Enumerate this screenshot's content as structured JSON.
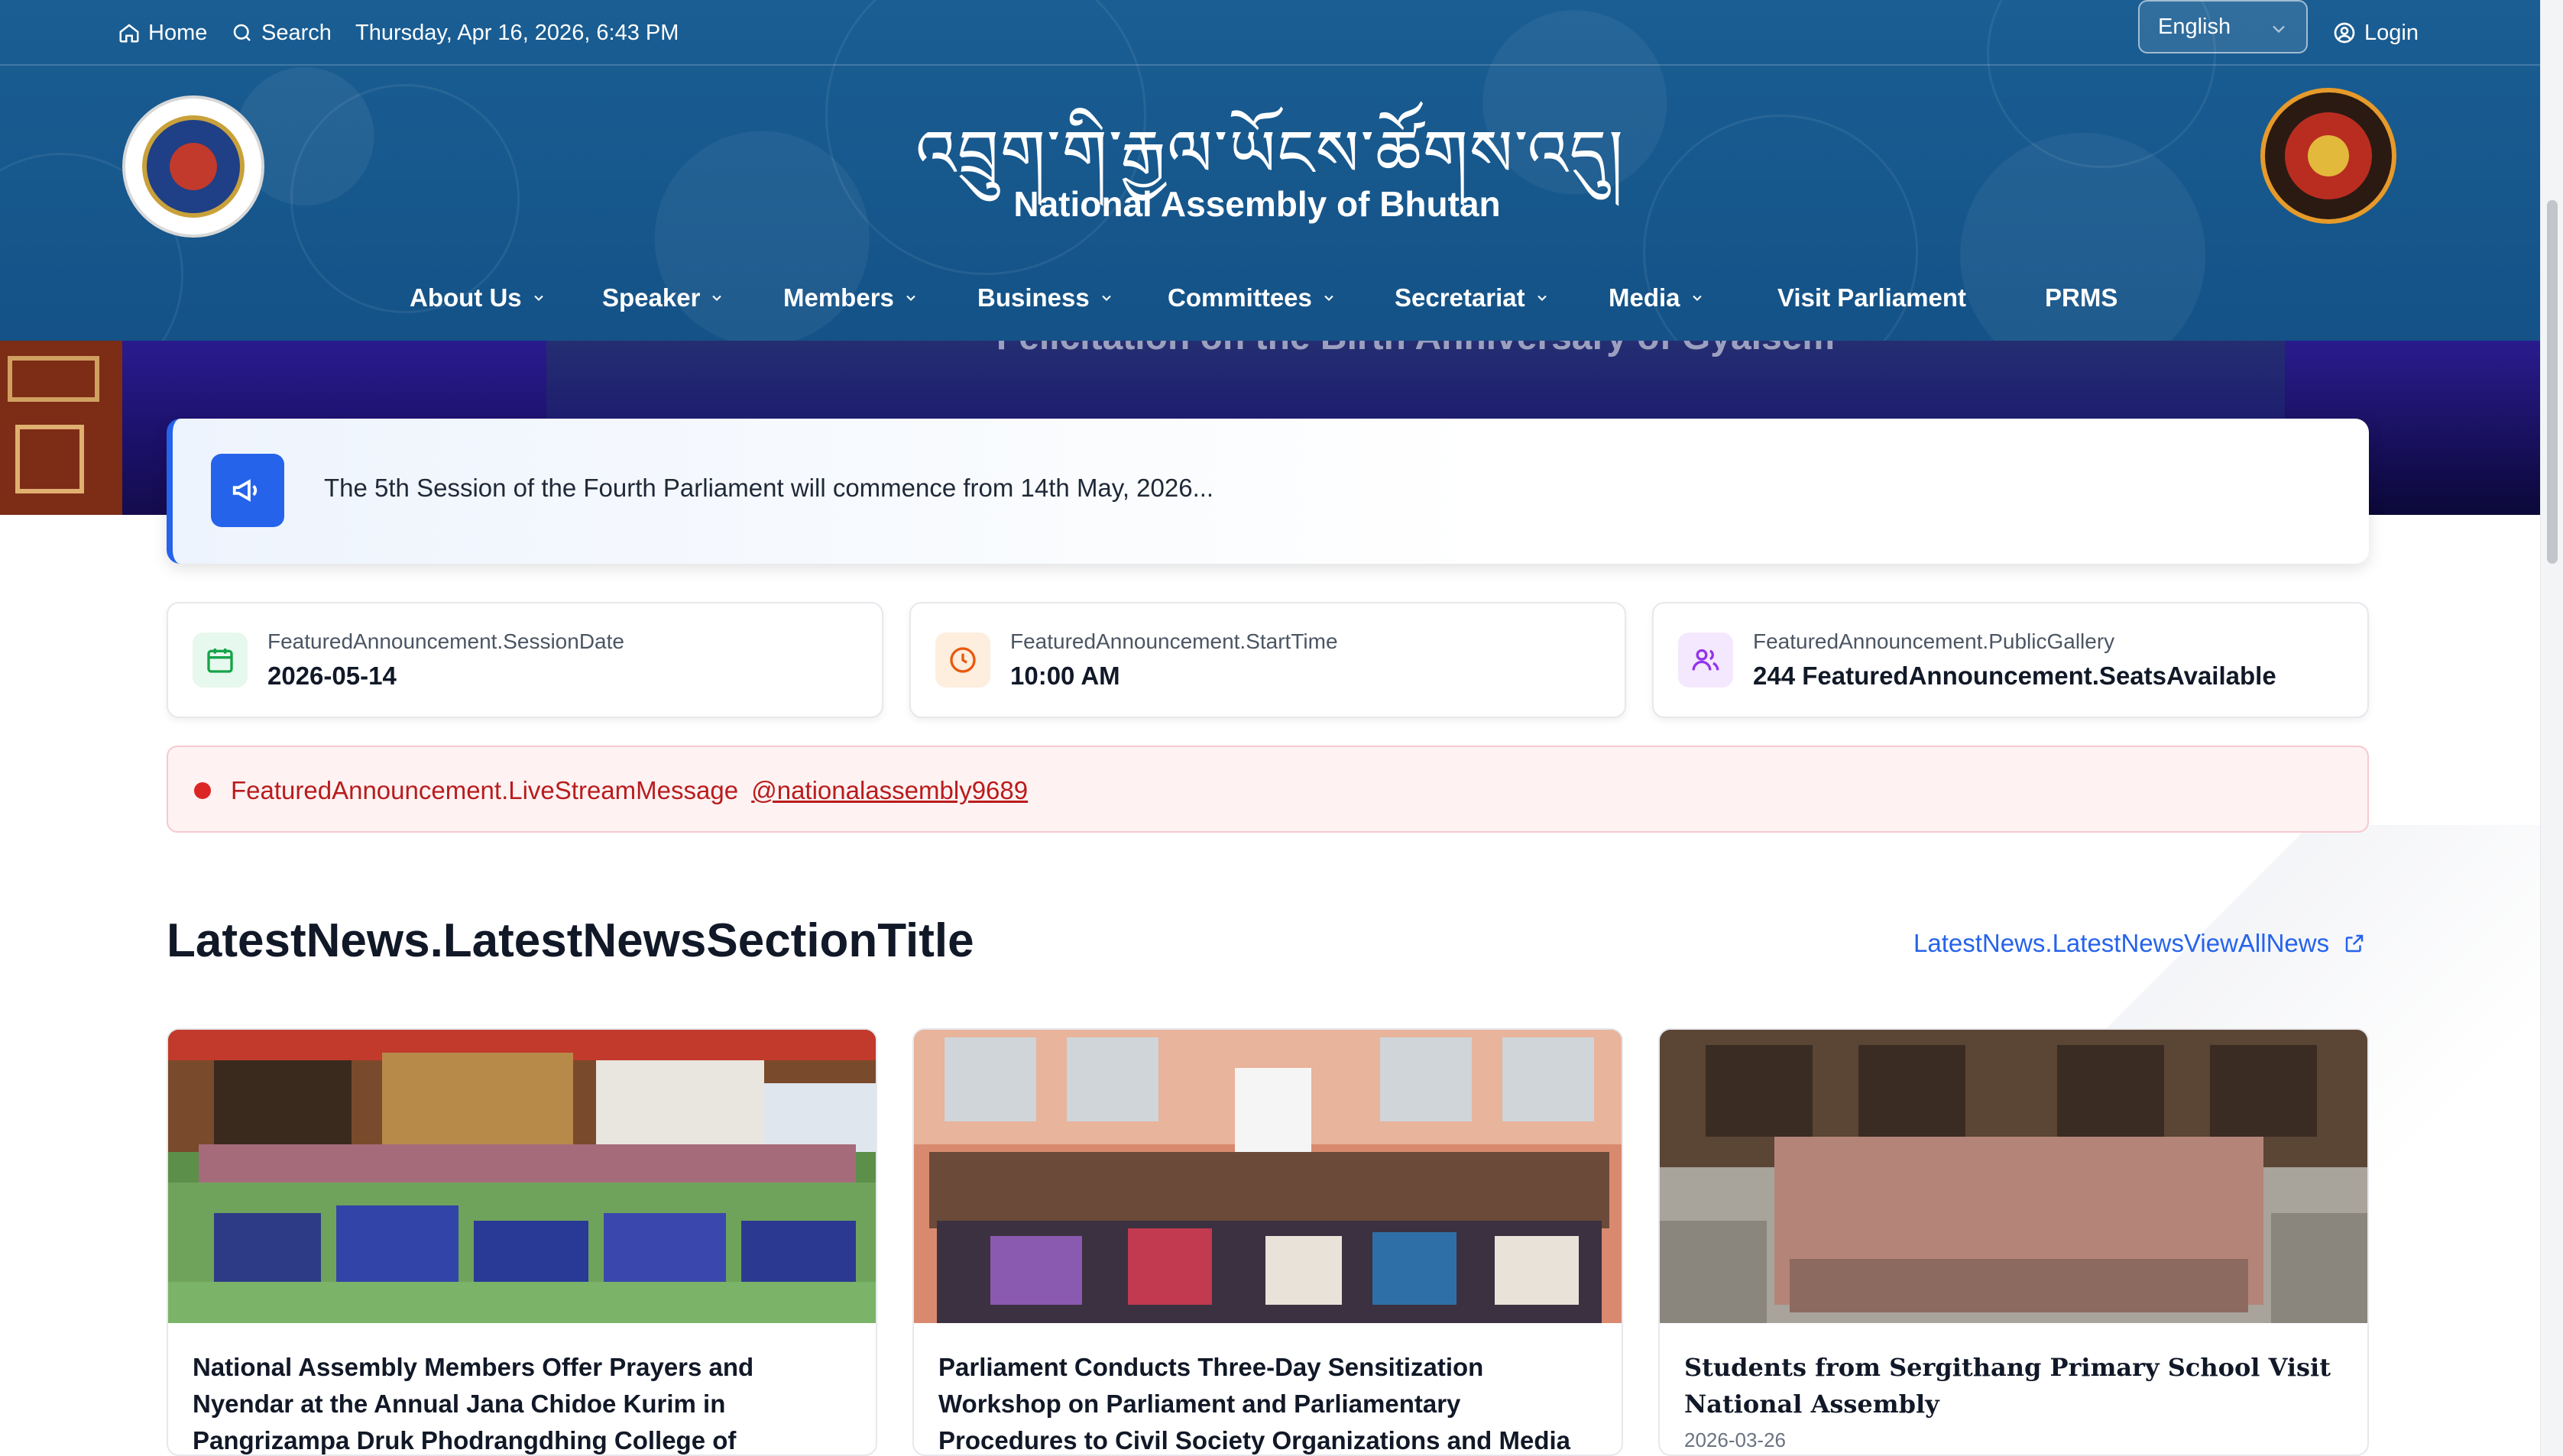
{
  "topbar": {
    "home_label": "Home",
    "search_label": "Search",
    "datetime": "Thursday, Apr 16, 2026, 6:43 PM",
    "language": "English",
    "login_label": "Login"
  },
  "header": {
    "title_dzongkha": "འབྲུག་གི་རྒྱལ་ཡོངས་ཚོགས་འདུ།",
    "title": "National Assembly of Bhutan"
  },
  "nav": {
    "items": [
      {
        "label": "About Us"
      },
      {
        "label": "Speaker"
      },
      {
        "label": "Members"
      },
      {
        "label": "Business"
      },
      {
        "label": "Committees"
      },
      {
        "label": "Secretariat"
      },
      {
        "label": "Media"
      },
      {
        "label": "Visit Parliament"
      },
      {
        "label": "PRMS"
      }
    ]
  },
  "hero": {
    "caption": "Felicitation on the Birth Anniversary of Gyalsem"
  },
  "announcement": {
    "text": "The 5th Session of the Fourth Parliament will commence from 14th May, 2026..."
  },
  "info_cards": [
    {
      "label": "FeaturedAnnouncement.SessionDate",
      "value": "2026-05-14",
      "icon": "calendar-icon",
      "tint": "#e7f8ee",
      "color": "#16a34a"
    },
    {
      "label": "FeaturedAnnouncement.StartTime",
      "value": "10:00 AM",
      "icon": "clock-icon",
      "tint": "#fdeede",
      "color": "#ea580c"
    },
    {
      "label": "FeaturedAnnouncement.PublicGallery",
      "value": "244 FeaturedAnnouncement.SeatsAvailable",
      "icon": "users-icon",
      "tint": "#f3e8fd",
      "color": "#9333ea"
    }
  ],
  "livestream": {
    "message": "FeaturedAnnouncement.LiveStreamMessage",
    "channel": "@nationalassembly9689"
  },
  "news": {
    "section_title": "LatestNews.LatestNewsSectionTitle",
    "view_all": "LatestNews.LatestNewsViewAllNews",
    "items": [
      {
        "headline": "National Assembly Members Offer Prayers and Nyendar at the Annual Jana Chidoe Kurim in Pangrizampa Druk Phodrangdhing College of Astrology",
        "date": ""
      },
      {
        "headline": "Parliament Conducts Three-Day Sensitization Workshop on Parliament and Parliamentary Procedures to Civil Society Organizations and Media",
        "date": ""
      },
      {
        "headline": "Students from Sergithang Primary School Visit National Assembly",
        "date": "2026-03-26"
      }
    ]
  },
  "colors": {
    "header_bg": "#145485",
    "accent": "#2563eb",
    "alert": "#dc2626"
  }
}
